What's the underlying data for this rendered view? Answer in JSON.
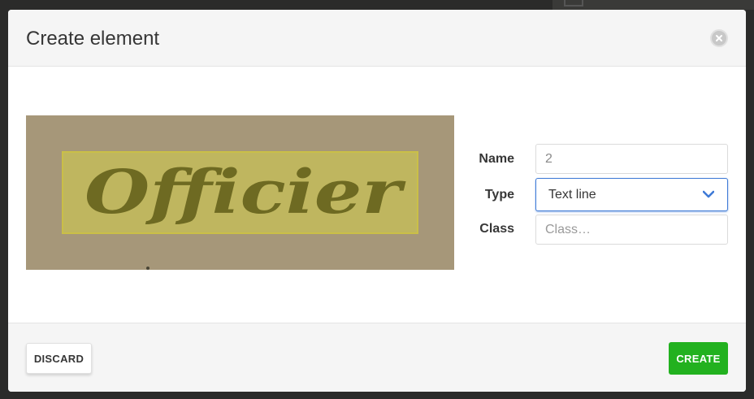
{
  "background": {
    "text": ""
  },
  "modal": {
    "title": "Create element",
    "close_icon": "close-icon"
  },
  "preview": {
    "image_text": "Officier",
    "highlight_color": "#e6e64a"
  },
  "form": {
    "name_label": "Name",
    "name_value": "2",
    "type_label": "Type",
    "type_value": "Text line",
    "class_label": "Class",
    "class_placeholder": "Class…"
  },
  "footer": {
    "discard_label": "DISCARD",
    "create_label": "CREATE"
  },
  "colors": {
    "create_button": "#22b11f",
    "select_focus": "#3e7ad6"
  }
}
